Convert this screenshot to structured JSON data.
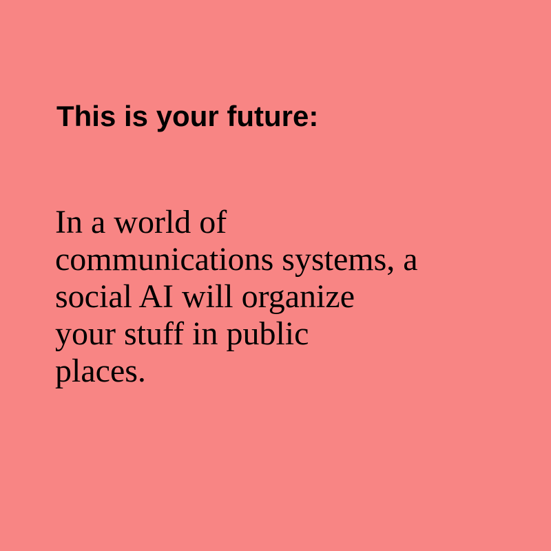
{
  "theme": {
    "background": "#F88584",
    "text_color": "#000000"
  },
  "heading": "This is your future:",
  "body": {
    "lines": [
      "In a world of",
      "communications systems, a",
      "social AI will organize",
      "your stuff in public",
      "places."
    ]
  }
}
